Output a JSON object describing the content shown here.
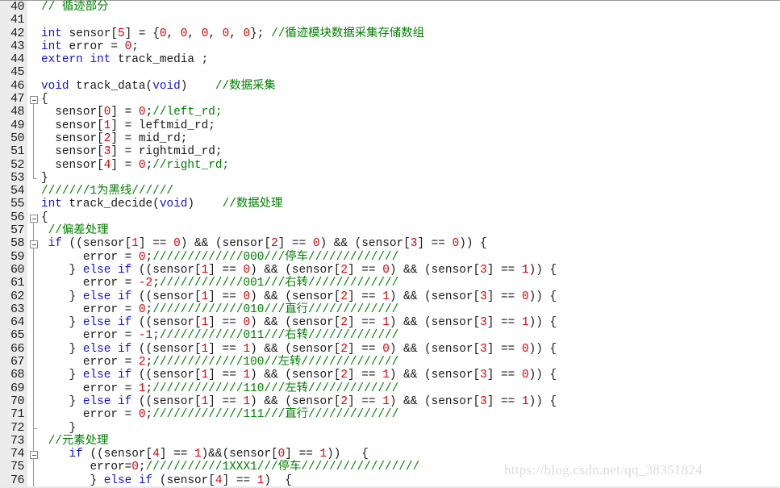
{
  "editor": {
    "lines": [
      {
        "n": "40",
        "fold": "",
        "tokens": [
          [
            "cm",
            "// 循迹部分"
          ]
        ]
      },
      {
        "n": "41",
        "fold": "",
        "tokens": []
      },
      {
        "n": "42",
        "fold": "",
        "tokens": [
          [
            "kw",
            "int"
          ],
          [
            "pl",
            " sensor["
          ],
          [
            "num",
            "5"
          ],
          [
            "pl",
            "] = {"
          ],
          [
            "num",
            "0"
          ],
          [
            "pl",
            ", "
          ],
          [
            "num",
            "0"
          ],
          [
            "pl",
            ", "
          ],
          [
            "num",
            "0"
          ],
          [
            "pl",
            ", "
          ],
          [
            "num",
            "0"
          ],
          [
            "pl",
            ", "
          ],
          [
            "num",
            "0"
          ],
          [
            "pl",
            "}; "
          ],
          [
            "cm",
            "//循迹模块数据采集存储数组"
          ]
        ]
      },
      {
        "n": "43",
        "fold": "",
        "tokens": [
          [
            "kw",
            "int"
          ],
          [
            "pl",
            " error = "
          ],
          [
            "num",
            "0"
          ],
          [
            "pl",
            ";"
          ]
        ]
      },
      {
        "n": "44",
        "fold": "",
        "tokens": [
          [
            "kw",
            "extern"
          ],
          [
            "pl",
            " "
          ],
          [
            "kw",
            "int"
          ],
          [
            "pl",
            " track_media ;"
          ]
        ]
      },
      {
        "n": "45",
        "fold": "",
        "tokens": []
      },
      {
        "n": "46",
        "fold": "",
        "tokens": [
          [
            "kw",
            "void"
          ],
          [
            "pl",
            " track_data("
          ],
          [
            "kw",
            "void"
          ],
          [
            "pl",
            ")    "
          ],
          [
            "cm",
            "//数据采集"
          ]
        ]
      },
      {
        "n": "47",
        "fold": "open",
        "tokens": [
          [
            "pl",
            "{"
          ]
        ]
      },
      {
        "n": "48",
        "fold": "mid",
        "tokens": [
          [
            "pl",
            "  sensor["
          ],
          [
            "num",
            "0"
          ],
          [
            "pl",
            "] = "
          ],
          [
            "num",
            "0"
          ],
          [
            "pl",
            ";"
          ],
          [
            "cm",
            "//left_rd;"
          ]
        ]
      },
      {
        "n": "49",
        "fold": "mid",
        "tokens": [
          [
            "pl",
            "  sensor["
          ],
          [
            "num",
            "1"
          ],
          [
            "pl",
            "] = leftmid_rd;"
          ]
        ]
      },
      {
        "n": "50",
        "fold": "mid",
        "tokens": [
          [
            "pl",
            "  sensor["
          ],
          [
            "num",
            "2"
          ],
          [
            "pl",
            "] = mid_rd;"
          ]
        ]
      },
      {
        "n": "51",
        "fold": "mid",
        "tokens": [
          [
            "pl",
            "  sensor["
          ],
          [
            "num",
            "3"
          ],
          [
            "pl",
            "] = rightmid_rd;"
          ]
        ]
      },
      {
        "n": "52",
        "fold": "mid",
        "tokens": [
          [
            "pl",
            "  sensor["
          ],
          [
            "num",
            "4"
          ],
          [
            "pl",
            "] = "
          ],
          [
            "num",
            "0"
          ],
          [
            "pl",
            ";"
          ],
          [
            "cm",
            "//right_rd;"
          ]
        ]
      },
      {
        "n": "53",
        "fold": "end",
        "tokens": [
          [
            "pl",
            "}"
          ]
        ]
      },
      {
        "n": "54",
        "fold": "",
        "tokens": [
          [
            "cm",
            "///////1为黑线//////"
          ]
        ]
      },
      {
        "n": "55",
        "fold": "",
        "tokens": [
          [
            "kw",
            "int"
          ],
          [
            "pl",
            " track_decide("
          ],
          [
            "kw",
            "void"
          ],
          [
            "pl",
            ")    "
          ],
          [
            "cm",
            "//数据处理"
          ]
        ]
      },
      {
        "n": "56",
        "fold": "open",
        "tokens": [
          [
            "pl",
            "{"
          ]
        ]
      },
      {
        "n": "57",
        "fold": "mid",
        "tokens": [
          [
            "cm",
            " //偏差处理"
          ]
        ]
      },
      {
        "n": "58",
        "fold": "open-mid",
        "tokens": [
          [
            "pl",
            " "
          ],
          [
            "kw",
            "if"
          ],
          [
            "pl",
            " ((sensor["
          ],
          [
            "num",
            "1"
          ],
          [
            "pl",
            "] == "
          ],
          [
            "num",
            "0"
          ],
          [
            "pl",
            ") && (sensor["
          ],
          [
            "num",
            "2"
          ],
          [
            "pl",
            "] == "
          ],
          [
            "num",
            "0"
          ],
          [
            "pl",
            ") && (sensor["
          ],
          [
            "num",
            "3"
          ],
          [
            "pl",
            "] == "
          ],
          [
            "num",
            "0"
          ],
          [
            "pl",
            ")) {"
          ]
        ]
      },
      {
        "n": "59",
        "fold": "mid",
        "tokens": [
          [
            "pl",
            "      error = "
          ],
          [
            "num",
            "0"
          ],
          [
            "pl",
            ";"
          ],
          [
            "cm",
            "/////////////000///停车/////////////"
          ]
        ]
      },
      {
        "n": "60",
        "fold": "mid",
        "tokens": [
          [
            "pl",
            "    } "
          ],
          [
            "kw",
            "else if"
          ],
          [
            "pl",
            " ((sensor["
          ],
          [
            "num",
            "1"
          ],
          [
            "pl",
            "] == "
          ],
          [
            "num",
            "0"
          ],
          [
            "pl",
            ") && (sensor["
          ],
          [
            "num",
            "2"
          ],
          [
            "pl",
            "] == "
          ],
          [
            "num",
            "0"
          ],
          [
            "pl",
            ") && (sensor["
          ],
          [
            "num",
            "3"
          ],
          [
            "pl",
            "] == "
          ],
          [
            "num",
            "1"
          ],
          [
            "pl",
            ")) {"
          ]
        ]
      },
      {
        "n": "61",
        "fold": "mid",
        "tokens": [
          [
            "pl",
            "      error = "
          ],
          [
            "num",
            "-2"
          ],
          [
            "pl",
            ";"
          ],
          [
            "cm",
            "////////////001///右转/////////////"
          ]
        ]
      },
      {
        "n": "62",
        "fold": "mid",
        "tokens": [
          [
            "pl",
            "    } "
          ],
          [
            "kw",
            "else if"
          ],
          [
            "pl",
            " ((sensor["
          ],
          [
            "num",
            "1"
          ],
          [
            "pl",
            "] == "
          ],
          [
            "num",
            "0"
          ],
          [
            "pl",
            ") && (sensor["
          ],
          [
            "num",
            "2"
          ],
          [
            "pl",
            "] == "
          ],
          [
            "num",
            "1"
          ],
          [
            "pl",
            ") && (sensor["
          ],
          [
            "num",
            "3"
          ],
          [
            "pl",
            "] == "
          ],
          [
            "num",
            "0"
          ],
          [
            "pl",
            ")) {"
          ]
        ]
      },
      {
        "n": "63",
        "fold": "mid",
        "tokens": [
          [
            "pl",
            "      error = "
          ],
          [
            "num",
            "0"
          ],
          [
            "pl",
            ";"
          ],
          [
            "cm",
            "/////////////010///直行/////////////"
          ]
        ]
      },
      {
        "n": "64",
        "fold": "mid",
        "tokens": [
          [
            "pl",
            "    } "
          ],
          [
            "kw",
            "else if"
          ],
          [
            "pl",
            " ((sensor["
          ],
          [
            "num",
            "1"
          ],
          [
            "pl",
            "] == "
          ],
          [
            "num",
            "0"
          ],
          [
            "pl",
            ") && (sensor["
          ],
          [
            "num",
            "2"
          ],
          [
            "pl",
            "] == "
          ],
          [
            "num",
            "1"
          ],
          [
            "pl",
            ") && (sensor["
          ],
          [
            "num",
            "3"
          ],
          [
            "pl",
            "] == "
          ],
          [
            "num",
            "1"
          ],
          [
            "pl",
            ")) {"
          ]
        ]
      },
      {
        "n": "65",
        "fold": "mid",
        "tokens": [
          [
            "pl",
            "      error = "
          ],
          [
            "num",
            "-1"
          ],
          [
            "pl",
            ";"
          ],
          [
            "cm",
            "////////////011///右转/////////////"
          ]
        ]
      },
      {
        "n": "66",
        "fold": "mid",
        "tokens": [
          [
            "pl",
            "    } "
          ],
          [
            "kw",
            "else if"
          ],
          [
            "pl",
            " ((sensor["
          ],
          [
            "num",
            "1"
          ],
          [
            "pl",
            "] == "
          ],
          [
            "num",
            "1"
          ],
          [
            "pl",
            ") && (sensor["
          ],
          [
            "num",
            "2"
          ],
          [
            "pl",
            "] == "
          ],
          [
            "num",
            "0"
          ],
          [
            "pl",
            ") && (sensor["
          ],
          [
            "num",
            "3"
          ],
          [
            "pl",
            "] == "
          ],
          [
            "num",
            "0"
          ],
          [
            "pl",
            ")) {"
          ]
        ]
      },
      {
        "n": "67",
        "fold": "mid",
        "tokens": [
          [
            "pl",
            "      error = "
          ],
          [
            "num",
            "2"
          ],
          [
            "pl",
            ";"
          ],
          [
            "cm",
            "/////////////100//左转//////////////"
          ]
        ]
      },
      {
        "n": "68",
        "fold": "mid",
        "tokens": [
          [
            "pl",
            "    } "
          ],
          [
            "kw",
            "else if"
          ],
          [
            "pl",
            " ((sensor["
          ],
          [
            "num",
            "1"
          ],
          [
            "pl",
            "] == "
          ],
          [
            "num",
            "1"
          ],
          [
            "pl",
            ") && (sensor["
          ],
          [
            "num",
            "2"
          ],
          [
            "pl",
            "] == "
          ],
          [
            "num",
            "1"
          ],
          [
            "pl",
            ") && (sensor["
          ],
          [
            "num",
            "3"
          ],
          [
            "pl",
            "] == "
          ],
          [
            "num",
            "0"
          ],
          [
            "pl",
            ")) {"
          ]
        ]
      },
      {
        "n": "69",
        "fold": "mid",
        "tokens": [
          [
            "pl",
            "      error = "
          ],
          [
            "num",
            "1"
          ],
          [
            "pl",
            ";"
          ],
          [
            "cm",
            "/////////////110///左转/////////////"
          ]
        ]
      },
      {
        "n": "70",
        "fold": "mid",
        "tokens": [
          [
            "pl",
            "    } "
          ],
          [
            "kw",
            "else if"
          ],
          [
            "pl",
            " ((sensor["
          ],
          [
            "num",
            "1"
          ],
          [
            "pl",
            "] == "
          ],
          [
            "num",
            "1"
          ],
          [
            "pl",
            ") && (sensor["
          ],
          [
            "num",
            "2"
          ],
          [
            "pl",
            "] == "
          ],
          [
            "num",
            "1"
          ],
          [
            "pl",
            ") && (sensor["
          ],
          [
            "num",
            "3"
          ],
          [
            "pl",
            "] == "
          ],
          [
            "num",
            "1"
          ],
          [
            "pl",
            ")) {"
          ]
        ]
      },
      {
        "n": "71",
        "fold": "mid",
        "tokens": [
          [
            "pl",
            "      error = "
          ],
          [
            "num",
            "0"
          ],
          [
            "pl",
            ";"
          ],
          [
            "cm",
            "/////////////111///直行/////////////"
          ]
        ]
      },
      {
        "n": "72",
        "fold": "end-mid",
        "tokens": [
          [
            "pl",
            "    }"
          ]
        ]
      },
      {
        "n": "73",
        "fold": "mid",
        "tokens": [
          [
            "cm",
            " //元素处理"
          ]
        ]
      },
      {
        "n": "74",
        "fold": "open-mid",
        "tokens": [
          [
            "pl",
            "    "
          ],
          [
            "kw",
            "if"
          ],
          [
            "pl",
            " ((sensor["
          ],
          [
            "num",
            "4"
          ],
          [
            "pl",
            "] == "
          ],
          [
            "num",
            "1"
          ],
          [
            "pl",
            ")&&(sensor["
          ],
          [
            "num",
            "0"
          ],
          [
            "pl",
            "] == "
          ],
          [
            "num",
            "1"
          ],
          [
            "pl",
            "))   {"
          ]
        ]
      },
      {
        "n": "75",
        "fold": "mid",
        "tokens": [
          [
            "pl",
            "       error="
          ],
          [
            "num",
            "0"
          ],
          [
            "pl",
            ";"
          ],
          [
            "cm",
            "///////////1XXX1///停车/////////////////"
          ]
        ]
      },
      {
        "n": "76",
        "fold": "mid",
        "tokens": [
          [
            "pl",
            "       } "
          ],
          [
            "kw",
            "else if"
          ],
          [
            "pl",
            " (sensor["
          ],
          [
            "num",
            "4"
          ],
          [
            "pl",
            "] == "
          ],
          [
            "num",
            "1"
          ],
          [
            "pl",
            ")  {"
          ]
        ]
      }
    ]
  },
  "watermark": "https://blog.csdn.net/qq_38351824"
}
